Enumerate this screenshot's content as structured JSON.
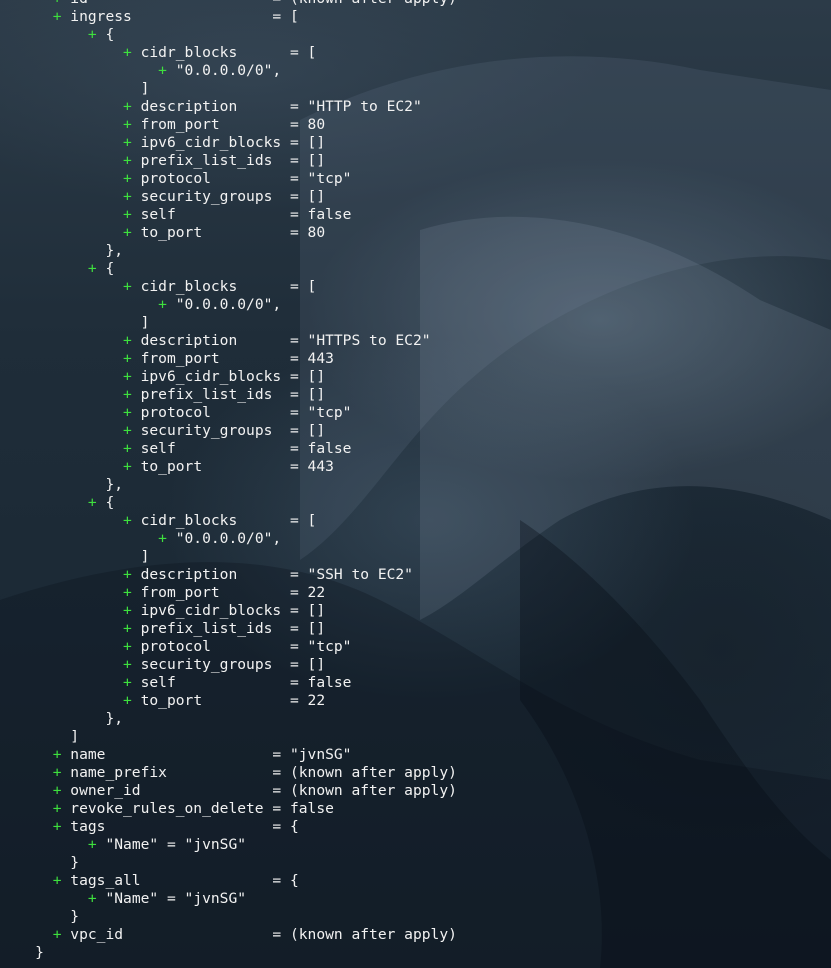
{
  "terminal": {
    "lines": [
      {
        "indent": "      ",
        "plus": "+",
        "text": " id                     = (known after apply)"
      },
      {
        "indent": "      ",
        "plus": "+",
        "text": " ingress                = ["
      },
      {
        "indent": "          ",
        "plus": "+",
        "text": " {"
      },
      {
        "indent": "              ",
        "plus": "+",
        "text": " cidr_blocks      = ["
      },
      {
        "indent": "                  ",
        "plus": "+",
        "text": " \"0.0.0.0/0\","
      },
      {
        "indent": "                ",
        "plus": "",
        "text": "]"
      },
      {
        "indent": "              ",
        "plus": "+",
        "text": " description      = \"HTTP to EC2\""
      },
      {
        "indent": "              ",
        "plus": "+",
        "text": " from_port        = 80"
      },
      {
        "indent": "              ",
        "plus": "+",
        "text": " ipv6_cidr_blocks = []"
      },
      {
        "indent": "              ",
        "plus": "+",
        "text": " prefix_list_ids  = []"
      },
      {
        "indent": "              ",
        "plus": "+",
        "text": " protocol         = \"tcp\""
      },
      {
        "indent": "              ",
        "plus": "+",
        "text": " security_groups  = []"
      },
      {
        "indent": "              ",
        "plus": "+",
        "text": " self             = false"
      },
      {
        "indent": "              ",
        "plus": "+",
        "text": " to_port          = 80"
      },
      {
        "indent": "            ",
        "plus": "",
        "text": "},"
      },
      {
        "indent": "          ",
        "plus": "+",
        "text": " {"
      },
      {
        "indent": "              ",
        "plus": "+",
        "text": " cidr_blocks      = ["
      },
      {
        "indent": "                  ",
        "plus": "+",
        "text": " \"0.0.0.0/0\","
      },
      {
        "indent": "                ",
        "plus": "",
        "text": "]"
      },
      {
        "indent": "              ",
        "plus": "+",
        "text": " description      = \"HTTPS to EC2\""
      },
      {
        "indent": "              ",
        "plus": "+",
        "text": " from_port        = 443"
      },
      {
        "indent": "              ",
        "plus": "+",
        "text": " ipv6_cidr_blocks = []"
      },
      {
        "indent": "              ",
        "plus": "+",
        "text": " prefix_list_ids  = []"
      },
      {
        "indent": "              ",
        "plus": "+",
        "text": " protocol         = \"tcp\""
      },
      {
        "indent": "              ",
        "plus": "+",
        "text": " security_groups  = []"
      },
      {
        "indent": "              ",
        "plus": "+",
        "text": " self             = false"
      },
      {
        "indent": "              ",
        "plus": "+",
        "text": " to_port          = 443"
      },
      {
        "indent": "            ",
        "plus": "",
        "text": "},"
      },
      {
        "indent": "          ",
        "plus": "+",
        "text": " {"
      },
      {
        "indent": "              ",
        "plus": "+",
        "text": " cidr_blocks      = ["
      },
      {
        "indent": "                  ",
        "plus": "+",
        "text": " \"0.0.0.0/0\","
      },
      {
        "indent": "                ",
        "plus": "",
        "text": "]"
      },
      {
        "indent": "              ",
        "plus": "+",
        "text": " description      = \"SSH to EC2\""
      },
      {
        "indent": "              ",
        "plus": "+",
        "text": " from_port        = 22"
      },
      {
        "indent": "              ",
        "plus": "+",
        "text": " ipv6_cidr_blocks = []"
      },
      {
        "indent": "              ",
        "plus": "+",
        "text": " prefix_list_ids  = []"
      },
      {
        "indent": "              ",
        "plus": "+",
        "text": " protocol         = \"tcp\""
      },
      {
        "indent": "              ",
        "plus": "+",
        "text": " security_groups  = []"
      },
      {
        "indent": "              ",
        "plus": "+",
        "text": " self             = false"
      },
      {
        "indent": "              ",
        "plus": "+",
        "text": " to_port          = 22"
      },
      {
        "indent": "            ",
        "plus": "",
        "text": "},"
      },
      {
        "indent": "        ",
        "plus": "",
        "text": "]"
      },
      {
        "indent": "      ",
        "plus": "+",
        "text": " name                   = \"jvnSG\""
      },
      {
        "indent": "      ",
        "plus": "+",
        "text": " name_prefix            = (known after apply)"
      },
      {
        "indent": "      ",
        "plus": "+",
        "text": " owner_id               = (known after apply)"
      },
      {
        "indent": "      ",
        "plus": "+",
        "text": " revoke_rules_on_delete = false"
      },
      {
        "indent": "      ",
        "plus": "+",
        "text": " tags                   = {"
      },
      {
        "indent": "          ",
        "plus": "+",
        "text": " \"Name\" = \"jvnSG\""
      },
      {
        "indent": "        ",
        "plus": "",
        "text": "}"
      },
      {
        "indent": "      ",
        "plus": "+",
        "text": " tags_all               = {"
      },
      {
        "indent": "          ",
        "plus": "+",
        "text": " \"Name\" = \"jvnSG\""
      },
      {
        "indent": "        ",
        "plus": "",
        "text": "}"
      },
      {
        "indent": "      ",
        "plus": "+",
        "text": " vpc_id                 = (known after apply)"
      },
      {
        "indent": "    ",
        "plus": "",
        "text": "}"
      }
    ]
  }
}
